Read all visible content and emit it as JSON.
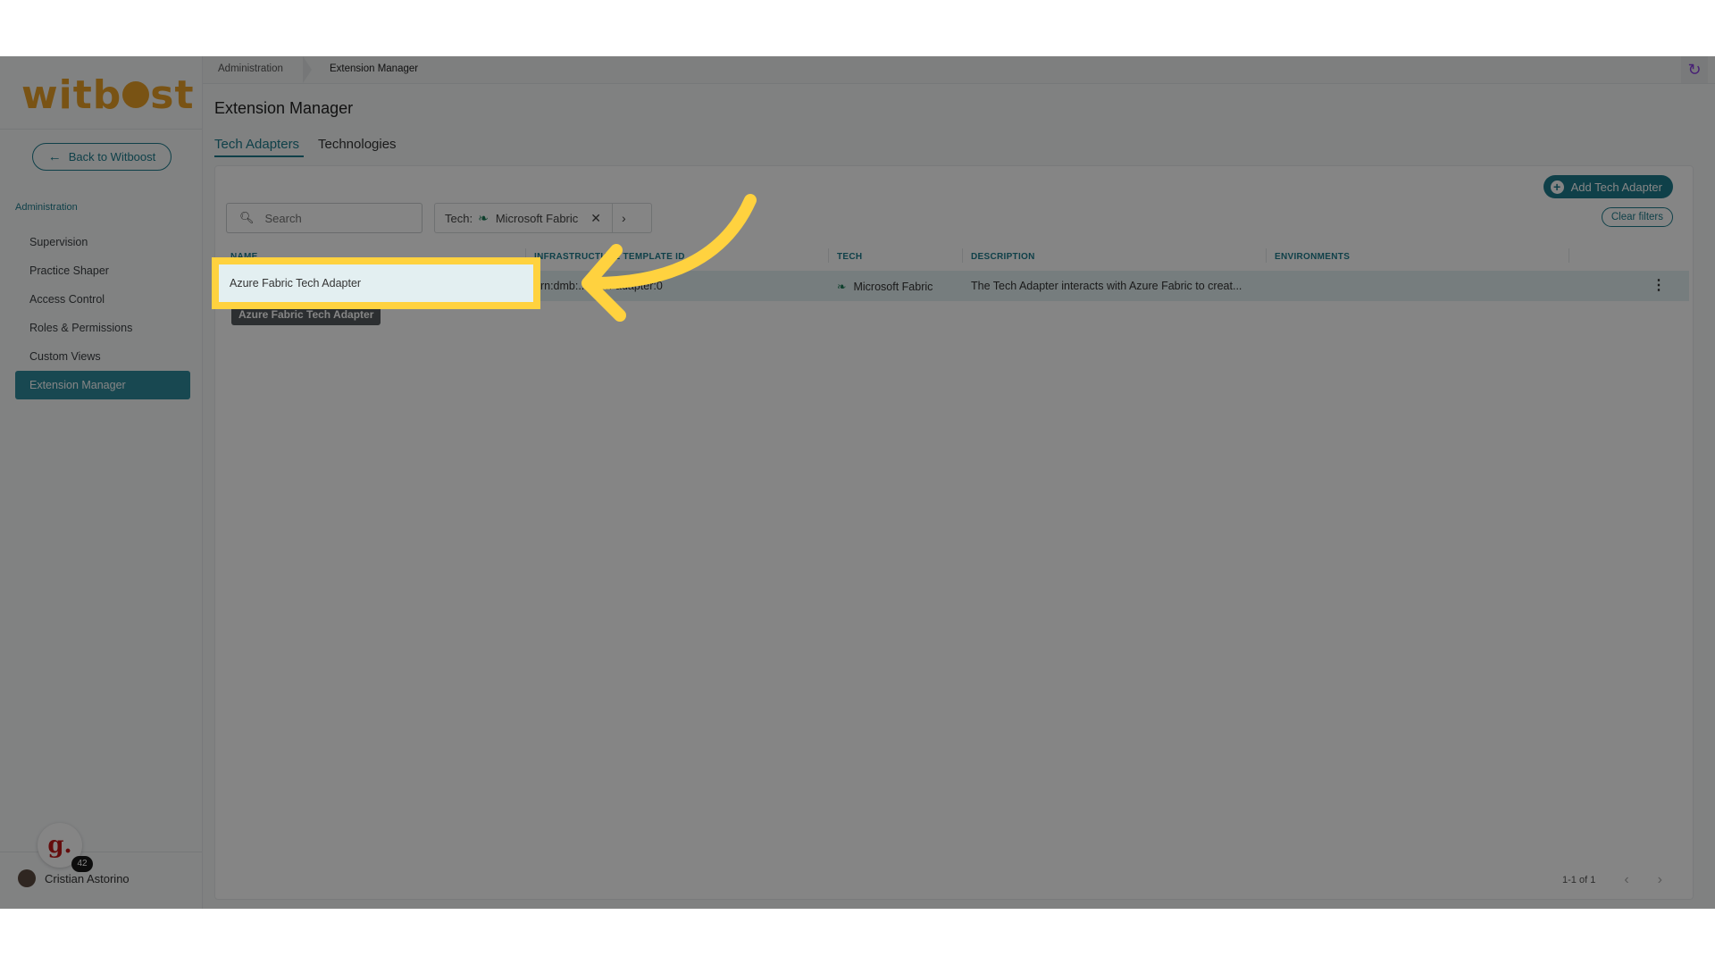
{
  "brand": {
    "logo_text_a": "witb",
    "logo_text_b": "st"
  },
  "sidebar": {
    "back_label": "Back to Witboost",
    "section_label": "Administration",
    "items": [
      {
        "label": "Supervision"
      },
      {
        "label": "Practice Shaper"
      },
      {
        "label": "Access Control"
      },
      {
        "label": "Roles & Permissions"
      },
      {
        "label": "Custom Views"
      },
      {
        "label": "Extension Manager",
        "active": true
      }
    ],
    "user_name": "Cristian Astorino",
    "badge_letter": "g.",
    "badge_count": "42"
  },
  "breadcrumb": {
    "first": "Administration",
    "second": "Extension Manager"
  },
  "page": {
    "title": "Extension Manager",
    "tabs": [
      {
        "label": "Tech Adapters",
        "active": true
      },
      {
        "label": "Technologies"
      }
    ]
  },
  "toolbar": {
    "add_label": "Add Tech Adapter",
    "clear_label": "Clear filters",
    "search_placeholder": "Search",
    "filter_label": "Tech:",
    "filter_value": "Microsoft Fabric"
  },
  "table": {
    "columns": [
      "NAME",
      "INFRASTRUCTURE TEMPLATE ID",
      "TECH",
      "DESCRIPTION",
      "ENVIRONMENTS"
    ],
    "rows": [
      {
        "name": "Azure Fabric Tech Adapter",
        "template_id": "urn:dmb:...:tech-adapter:0",
        "tech": "Microsoft Fabric",
        "description": "The Tech Adapter interacts with Azure Fabric to creat...",
        "environments": ""
      }
    ],
    "tooltip": "Azure Fabric Tech Adapter"
  },
  "pagination": {
    "range": "1-1 of 1"
  },
  "colors": {
    "accent": "#1e7c8c",
    "highlight": "#ffd23f",
    "sync": "#8a3fe0"
  }
}
